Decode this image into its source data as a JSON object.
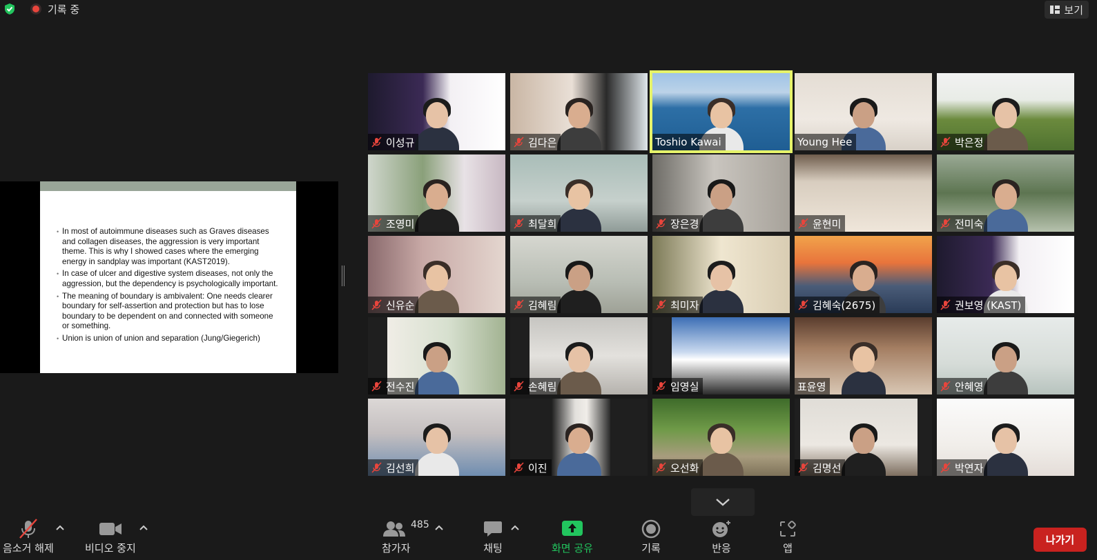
{
  "topbar": {
    "recording_label": "기록 중",
    "view_label": "보기"
  },
  "slide": {
    "bullets": [
      "In most of autoimmune diseases such as Graves diseases and collagen diseases, the aggression is very important theme. This is why I showed cases where the emerging energy in sandplay was important (KAST2019).",
      "In case of ulcer and digestive system diseases, not only the aggression, but the dependency is psychologically important.",
      "The meaning of boundary is ambivalent: One needs clearer boundary for self-assertion and protection but has to lose boundary to be dependent on and connected with someone or something.",
      "Union is union of union and separation (Jung/Giegerich)"
    ]
  },
  "participants": [
    {
      "name": "이성규",
      "muted": true
    },
    {
      "name": "김다은",
      "muted": true
    },
    {
      "name": "Toshio Kawai",
      "muted": false,
      "active": true
    },
    {
      "name": "Young Hee",
      "muted": false
    },
    {
      "name": "박은정",
      "muted": true
    },
    {
      "name": "조영미",
      "muted": true
    },
    {
      "name": "최달희",
      "muted": true
    },
    {
      "name": "장은경",
      "muted": true
    },
    {
      "name": "윤현미",
      "muted": true
    },
    {
      "name": "전미숙",
      "muted": true
    },
    {
      "name": "신유순",
      "muted": true
    },
    {
      "name": "김혜림",
      "muted": true
    },
    {
      "name": "최미자",
      "muted": true
    },
    {
      "name": "김혜숙(2675)",
      "muted": true
    },
    {
      "name": "권보영 (KAST)",
      "muted": true
    },
    {
      "name": "전수진",
      "muted": true
    },
    {
      "name": "손혜림",
      "muted": true
    },
    {
      "name": "임영실",
      "muted": true
    },
    {
      "name": "표윤영",
      "muted": false
    },
    {
      "name": "안혜영",
      "muted": true
    },
    {
      "name": "김선희",
      "muted": true
    },
    {
      "name": "이진",
      "muted": true
    },
    {
      "name": "오선화",
      "muted": true
    },
    {
      "name": "김명선",
      "muted": true
    },
    {
      "name": "박연자",
      "muted": true
    }
  ],
  "toolbar": {
    "unmute_label": "음소거 해제",
    "stop_video_label": "비디오 중지",
    "participants_label": "참가자",
    "participants_count": "485",
    "chat_label": "채팅",
    "share_label": "화면 공유",
    "record_label": "기록",
    "reactions_label": "반응",
    "apps_label": "앱",
    "leave_label": "나가기"
  },
  "colors": {
    "background": "#1a1a1a",
    "active_speaker": "#e6f36a",
    "leave": "#c9221f",
    "share": "#22c55e",
    "mute_red": "#e8453c"
  }
}
